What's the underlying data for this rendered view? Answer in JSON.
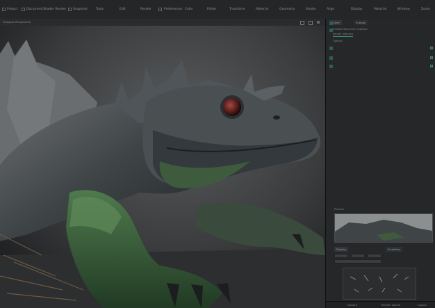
{
  "menubar": {
    "items": [
      "Snapshot",
      "Tools",
      "Edit",
      "Render",
      "Preferences",
      "Color",
      "Picker",
      "Transform",
      "Material",
      "Geometry",
      "Stroke",
      "Layer",
      "Tab"
    ],
    "left_items": [
      "Project",
      "Document",
      "Shader Render"
    ],
    "right_items": [
      "Align",
      "Display",
      "Material",
      "Window",
      "Zoom"
    ]
  },
  "viewport": {
    "title": "Viewport Perspective"
  },
  "panel": {
    "tabs": [
      "Scene",
      "Subtool"
    ],
    "rows": [
      "Subtool Document Inspector",
      "Render Selected",
      "Options"
    ],
    "section2": "Preview",
    "section3_tabs": [
      "Display",
      "Sculpting"
    ],
    "footer": [
      "Camera",
      "Render Layers",
      "Layers"
    ]
  },
  "colors": {
    "accent": "#3d8577",
    "background": "#1f2021"
  }
}
